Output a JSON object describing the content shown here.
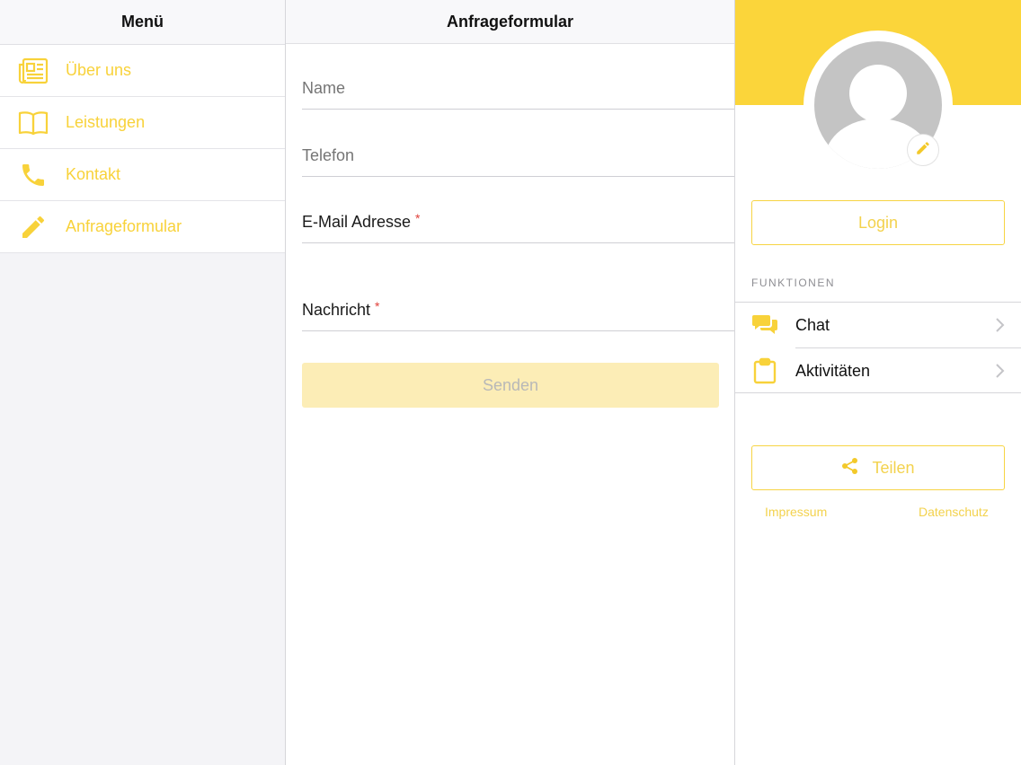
{
  "colors": {
    "accent": "#fbd53a",
    "accent_text": "#f3d24d",
    "required": "#e0403a",
    "disabled_button_bg": "#fcedb6"
  },
  "menu": {
    "title": "Menü",
    "items": [
      {
        "label": "Über uns",
        "icon": "newspaper-icon"
      },
      {
        "label": "Leistungen",
        "icon": "open-book-icon"
      },
      {
        "label": "Kontakt",
        "icon": "phone-icon"
      },
      {
        "label": "Anfrageformular",
        "icon": "pencil-icon"
      }
    ]
  },
  "form": {
    "title": "Anfrageformular",
    "fields": {
      "name": {
        "placeholder": "Name",
        "value": ""
      },
      "phone": {
        "placeholder": "Telefon",
        "value": ""
      },
      "email": {
        "label": "E-Mail Adresse",
        "required_mark": "*",
        "value": ""
      },
      "message": {
        "label": "Nachricht",
        "required_mark": "*",
        "value": ""
      }
    },
    "submit_label": "Senden"
  },
  "profile": {
    "login_label": "Login",
    "section_title": "FUNKTIONEN",
    "functions": [
      {
        "label": "Chat",
        "icon": "chat-bubbles-icon"
      },
      {
        "label": "Aktivitäten",
        "icon": "clipboard-icon"
      }
    ],
    "share_label": "Teilen",
    "footer": {
      "imprint": "Impressum",
      "privacy": "Datenschutz"
    }
  }
}
